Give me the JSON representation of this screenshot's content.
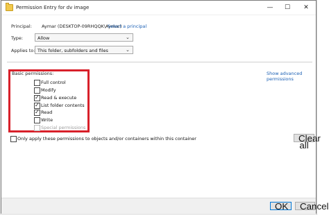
{
  "window": {
    "title": "Permission Entry for dv image",
    "minimize_symbol": "—",
    "maximize_symbol": "☐",
    "close_symbol": "✕"
  },
  "principal": {
    "label": "Principal:",
    "value": "Aymar (DESKTOP-09RHQQK\\Aymar)",
    "select_link": "Select a principal"
  },
  "type": {
    "label": "Type:",
    "value": "Allow"
  },
  "applies_to": {
    "label": "Applies to:",
    "value": "This folder, subfolders and files"
  },
  "basic_permissions": {
    "heading": "Basic permissions:",
    "show_advanced_link": "Show advanced permissions",
    "items": [
      {
        "label": "Full control",
        "checked": false,
        "disabled": false
      },
      {
        "label": "Modify",
        "checked": false,
        "disabled": false
      },
      {
        "label": "Read & execute",
        "checked": true,
        "disabled": false
      },
      {
        "label": "List folder contents",
        "checked": true,
        "disabled": false
      },
      {
        "label": "Read",
        "checked": true,
        "disabled": false
      },
      {
        "label": "Write",
        "checked": false,
        "disabled": false
      },
      {
        "label": "Special permissions",
        "checked": false,
        "disabled": true
      }
    ]
  },
  "only_apply": {
    "label": "Only apply these permissions to objects and/or containers within this container",
    "checked": false
  },
  "buttons": {
    "clear_all": "Clear all",
    "ok": "OK",
    "cancel": "Cancel"
  },
  "colors": {
    "highlight_box": "#d8202a",
    "link": "#1a5fb4",
    "default_button_border": "#0078d7"
  },
  "icons": {
    "title": "folder-icon",
    "dropdown": "chevron-down-icon",
    "checkmark": "check-icon"
  }
}
